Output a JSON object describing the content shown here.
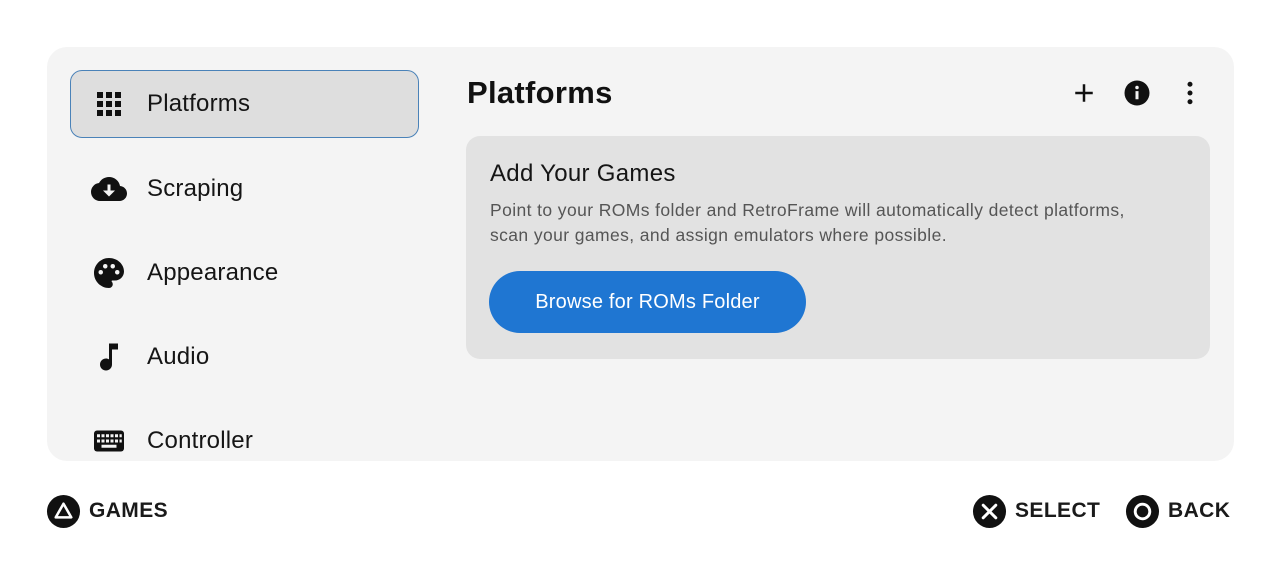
{
  "sidebar": {
    "items": [
      {
        "label": "Platforms",
        "icon": "grid-icon",
        "active": true
      },
      {
        "label": "Scraping",
        "icon": "cloud-download-icon",
        "active": false
      },
      {
        "label": "Appearance",
        "icon": "palette-icon",
        "active": false
      },
      {
        "label": "Audio",
        "icon": "music-note-icon",
        "active": false
      },
      {
        "label": "Controller",
        "icon": "keyboard-icon",
        "active": false
      }
    ]
  },
  "main": {
    "title": "Platforms",
    "actions": [
      {
        "icon": "add-icon"
      },
      {
        "icon": "info-icon"
      },
      {
        "icon": "more-vert-icon"
      }
    ],
    "card": {
      "title": "Add Your Games",
      "description": "Point to your ROMs folder and RetroFrame will automatically detect platforms, scan your games, and assign emulators where possible.",
      "button_label": "Browse for ROMs Folder"
    }
  },
  "footer": {
    "left": {
      "label": "GAMES",
      "icon": "triangle-button-icon"
    },
    "right": [
      {
        "label": "SELECT",
        "icon": "cross-button-icon"
      },
      {
        "label": "BACK",
        "icon": "circle-button-icon"
      }
    ]
  },
  "colors": {
    "accent": "#1f76d2",
    "active_border": "#4a82b8",
    "panel_bg": "#f4f4f4",
    "card_bg": "#e2e2e2"
  }
}
